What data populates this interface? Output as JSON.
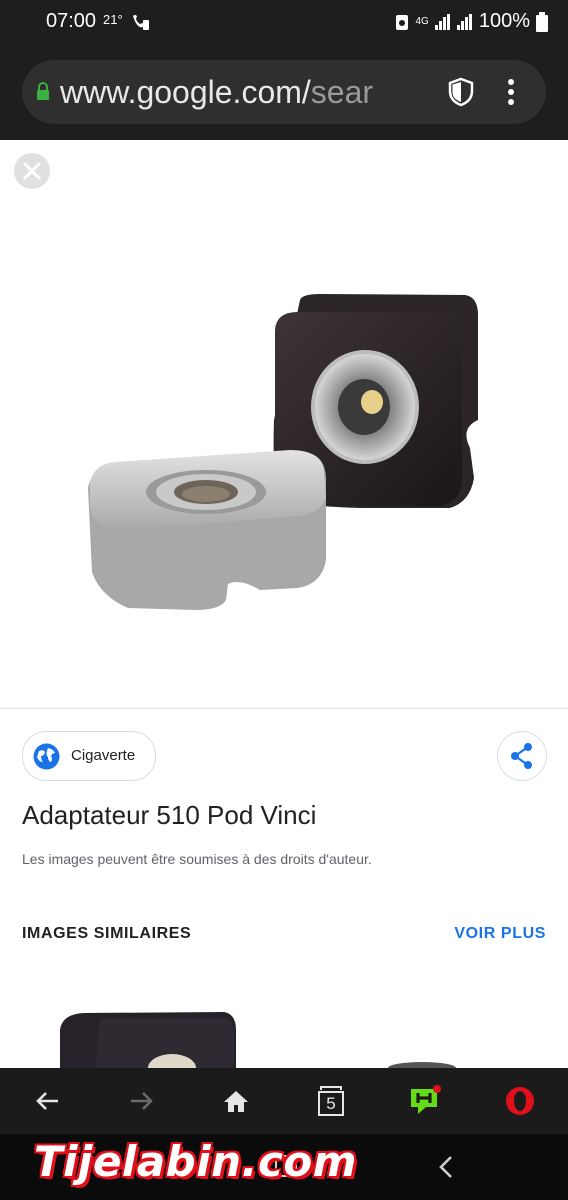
{
  "status_bar": {
    "time": "07:00",
    "temperature": "21°",
    "network": "4G",
    "battery": "100%"
  },
  "browser": {
    "url_main": "www.google.com/",
    "url_tail": "sear"
  },
  "result": {
    "source_name": "Cigaverte",
    "title": "Adaptateur 510 Pod Vinci",
    "copyright_notice": "Les images peuvent être soumises à des droits d'auteur.",
    "similar_heading": "IMAGES SIMILAIRES",
    "see_more": "VOIR PLUS"
  },
  "bottom_nav": {
    "tab_count": "5"
  },
  "watermark": "Tijelabin.com",
  "colors": {
    "accent": "#1a73e8",
    "opera_red": "#e0101b",
    "app_green": "#64dd17"
  }
}
